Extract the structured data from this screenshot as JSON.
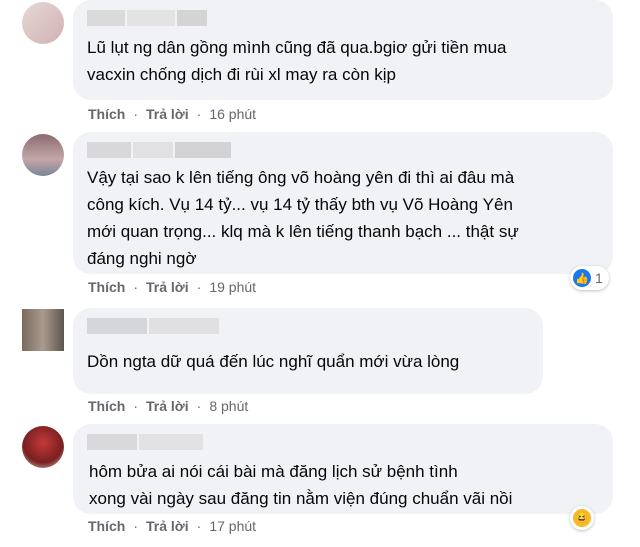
{
  "comments": [
    {
      "text": "Lũ lụt ng dân gồng mình cũng đã qua.bgiơ gửi tiền mua\nvacxin chống dịch đi rùi xl may ra còn kịp",
      "like_label": "Thích",
      "reply_label": "Trả lời",
      "time": "16 phút"
    },
    {
      "text": "Vậy tại sao k lên tiếng ông võ hoàng yên đi thì ai đâu mà\ncông kích. Vụ 14 tỷ... vụ 14 tỷ thấy bth vụ Võ Hoàng Yên\nmới quan trọng... klq mà k lên tiếng thanh bạch ... thật sự\nđáng nghi ngờ",
      "like_label": "Thích",
      "reply_label": "Trả lời",
      "time": "19 phút",
      "reaction_count": "1",
      "reaction_icon": "like-icon"
    },
    {
      "text": "Dồn ngta dữ quá đến lúc nghĩ quẩn mới vừa lòng",
      "like_label": "Thích",
      "reply_label": "Trả lời",
      "time": "8 phút"
    },
    {
      "text": "hôm bửa ai nói cái bài mà đăng lịch sử bệnh tình\nxong vài ngày sau đăng tin nằm viện đúng chuẩn vãi nồi",
      "like_label": "Thích",
      "reply_label": "Trả lời",
      "time": "17 phút",
      "reaction_icon": "haha-icon"
    }
  ],
  "colors": {
    "bubble": "#f0f2f5",
    "action_text": "#65676b",
    "like_blue": "#1877f2",
    "haha_yellow": "#f7b928"
  }
}
